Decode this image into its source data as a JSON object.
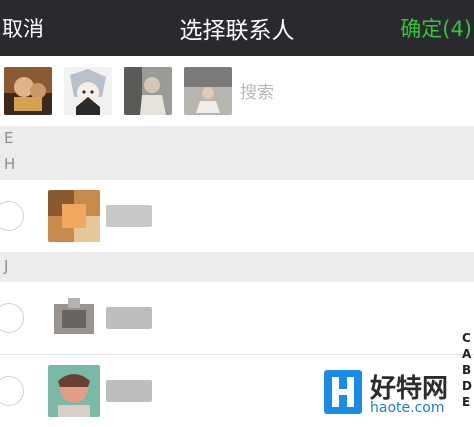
{
  "header": {
    "cancel_label": "取消",
    "title": "选择联系人",
    "confirm_label": "确定(4)",
    "confirm_color": "#36c23b",
    "background": "#2a2a2e"
  },
  "selected_strip": {
    "search_placeholder": "搜索",
    "avatars": [
      {
        "name": "selected-avatar-1"
      },
      {
        "name": "selected-avatar-2"
      },
      {
        "name": "selected-avatar-3"
      },
      {
        "name": "selected-avatar-4"
      }
    ]
  },
  "sections": [
    {
      "letter": "E"
    },
    {
      "letter": "H"
    },
    {
      "letter": "J"
    }
  ],
  "contacts": [
    {
      "section": "H",
      "selected": false
    },
    {
      "section": "J",
      "selected": false
    },
    {
      "section": "J",
      "selected": false
    }
  ],
  "index_bar": {
    "letters": [
      "C",
      "A",
      "B",
      "D",
      "E"
    ]
  },
  "watermark": {
    "text_cn": "好特网",
    "text_en": "haote.com"
  }
}
